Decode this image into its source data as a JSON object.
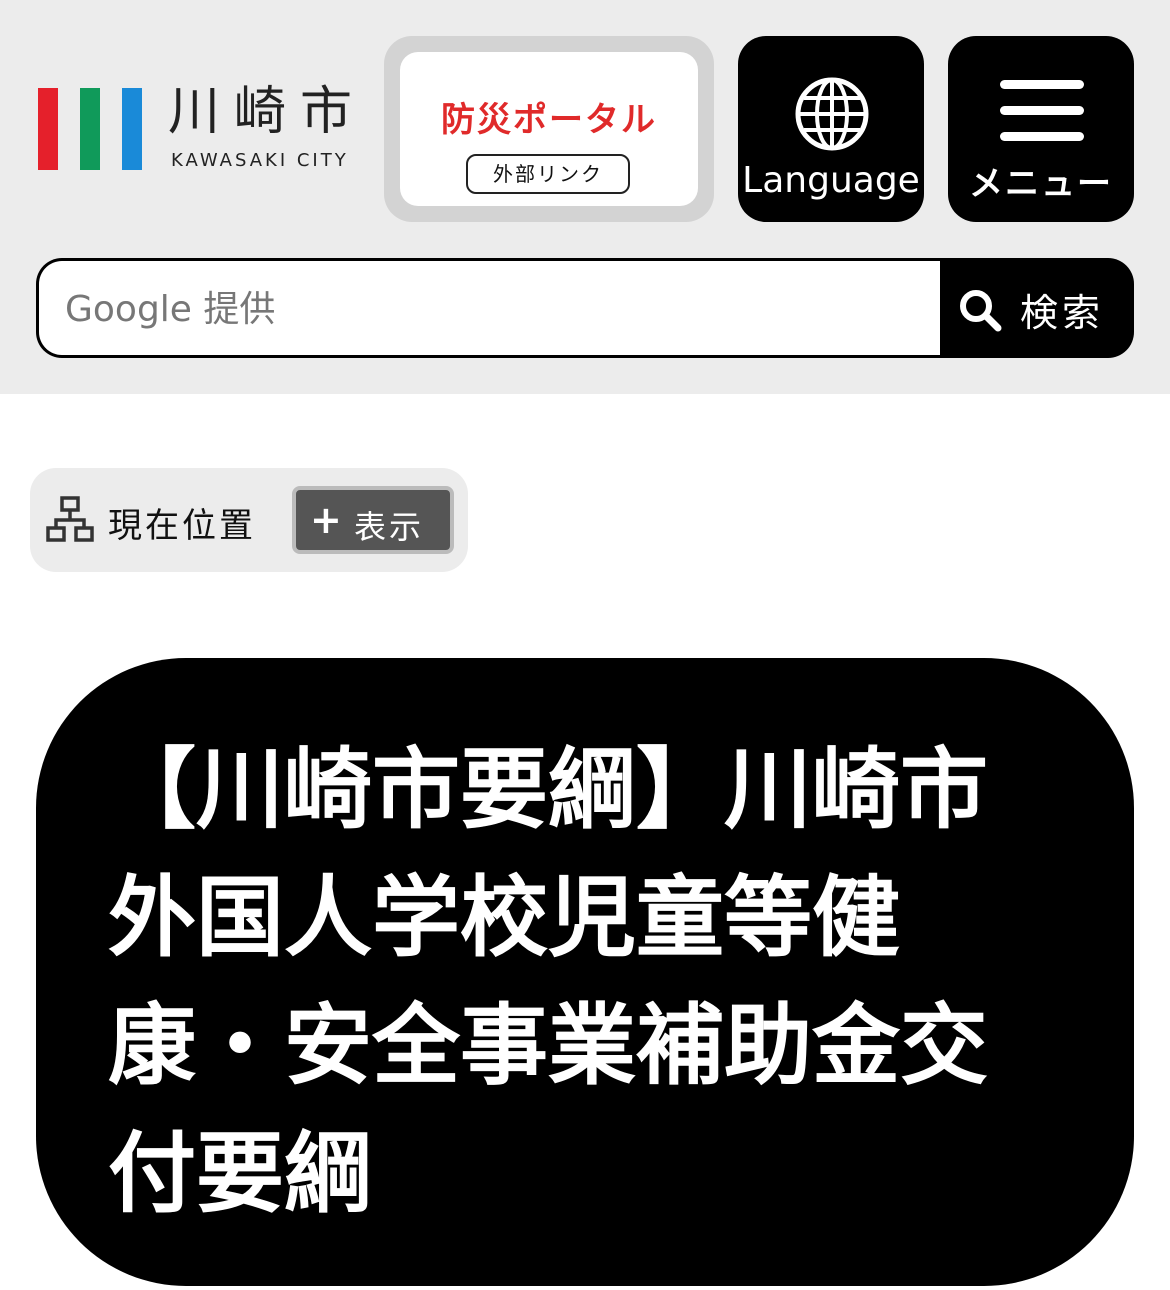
{
  "header": {
    "logo": {
      "name_jp": "川崎市",
      "name_en": "KAWASAKI CITY",
      "colors": [
        "#e5202b",
        "#109a5a",
        "#1a8ad8"
      ]
    },
    "bousai": {
      "title": "防災ポータル",
      "badge": "外部リンク",
      "title_color": "#e02a2a"
    },
    "language": {
      "label": "Language",
      "icon": "globe-icon"
    },
    "menu": {
      "label": "メニュー",
      "icon": "hamburger-icon"
    },
    "search": {
      "placeholder": "Google 提供",
      "value": "",
      "button_label": "検索",
      "icon": "search-icon"
    }
  },
  "breadcrumb": {
    "label": "現在位置",
    "toggle_label": "表示",
    "toggle_symbol": "+",
    "icon": "sitemap-icon"
  },
  "page": {
    "title": "【川崎市要綱】川崎市外国人学校児童等健康・安全事業補助金交付要綱"
  }
}
